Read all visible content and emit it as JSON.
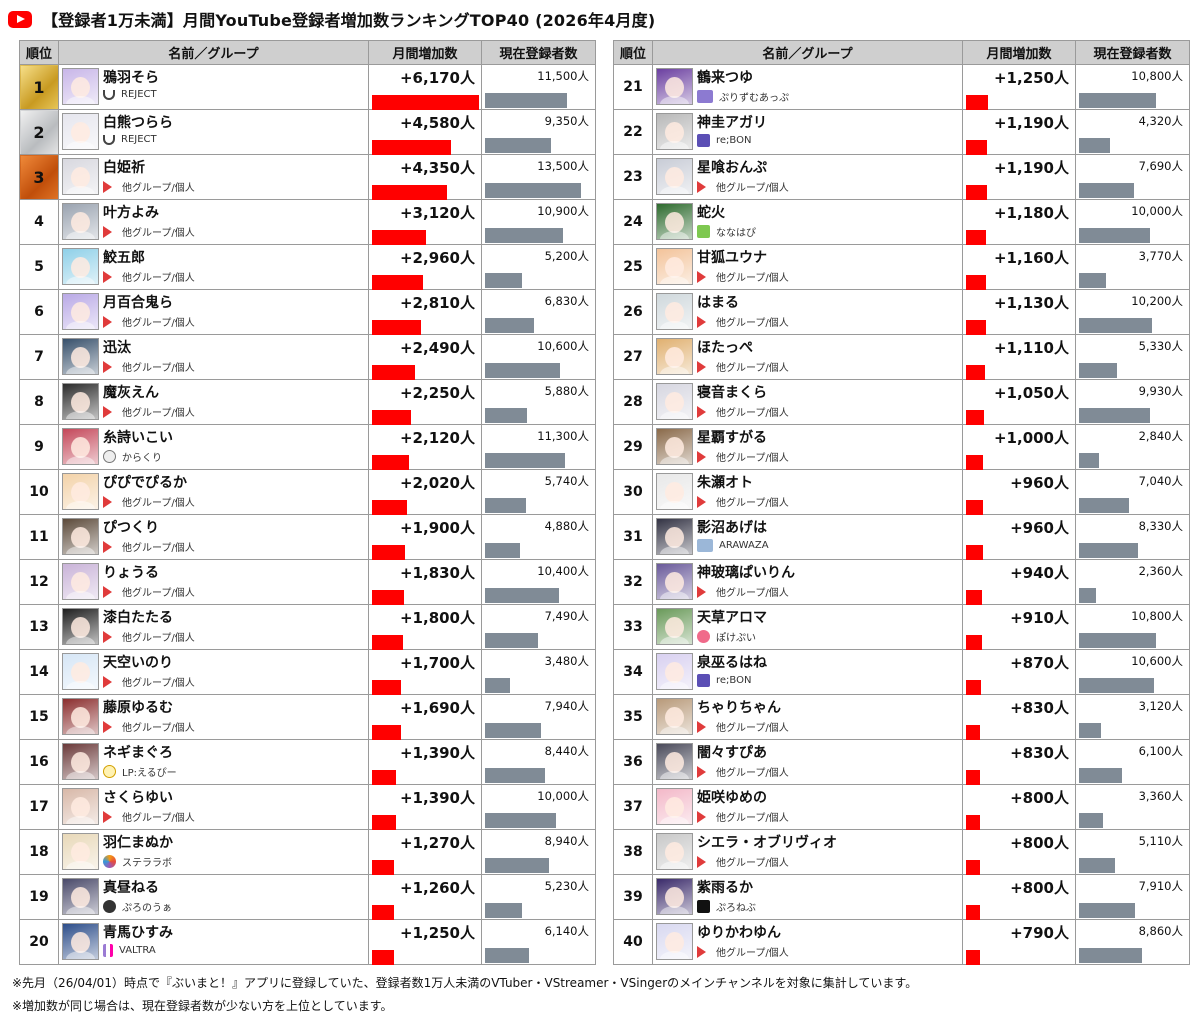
{
  "title": "【登録者1万未満】月間YouTube登録者増加数ランキングTOP40 (2026年4月度)",
  "colors": {
    "increase_bar": "#ff0000",
    "subscribers_bar": "#808b96",
    "header_bg": "#cfcfcf"
  },
  "headers": {
    "rank": "順位",
    "name": "名前／グループ",
    "increase": "月間増加数",
    "subscribers": "現在登録者数"
  },
  "entries": [
    {
      "rank": "1",
      "name": "鴉羽そら",
      "group": "REJECT",
      "icon": "reject",
      "increase": "+6,170人",
      "subscribers": "11,500人"
    },
    {
      "rank": "2",
      "name": "白熊つらら",
      "group": "REJECT",
      "icon": "reject",
      "increase": "+4,580人",
      "subscribers": "9,350人"
    },
    {
      "rank": "3",
      "name": "白姫祈",
      "group": "他グループ/個人",
      "icon": "play",
      "increase": "+4,350人",
      "subscribers": "13,500人"
    },
    {
      "rank": "4",
      "name": "叶方よみ",
      "group": "他グループ/個人",
      "icon": "play",
      "increase": "+3,120人",
      "subscribers": "10,900人"
    },
    {
      "rank": "5",
      "name": "鮫五郎",
      "group": "他グループ/個人",
      "icon": "play",
      "increase": "+2,960人",
      "subscribers": "5,200人"
    },
    {
      "rank": "6",
      "name": "月百合鬼ら",
      "group": "他グループ/個人",
      "icon": "play",
      "increase": "+2,810人",
      "subscribers": "6,830人"
    },
    {
      "rank": "7",
      "name": "迅汰",
      "group": "他グループ/個人",
      "icon": "play",
      "increase": "+2,490人",
      "subscribers": "10,600人"
    },
    {
      "rank": "8",
      "name": "魔灰えん",
      "group": "他グループ/個人",
      "icon": "play",
      "increase": "+2,250人",
      "subscribers": "5,880人"
    },
    {
      "rank": "9",
      "name": "糸詩いこい",
      "group": "からくり",
      "icon": "karakuri",
      "increase": "+2,120人",
      "subscribers": "11,300人"
    },
    {
      "rank": "10",
      "name": "ぴぴでぴるか",
      "group": "他グループ/個人",
      "icon": "play",
      "increase": "+2,020人",
      "subscribers": "5,740人"
    },
    {
      "rank": "11",
      "name": "ぴつくり",
      "group": "他グループ/個人",
      "icon": "play",
      "increase": "+1,900人",
      "subscribers": "4,880人"
    },
    {
      "rank": "12",
      "name": "りょうる",
      "group": "他グループ/個人",
      "icon": "play",
      "increase": "+1,830人",
      "subscribers": "10,400人"
    },
    {
      "rank": "13",
      "name": "漆白たたる",
      "group": "他グループ/個人",
      "icon": "play",
      "increase": "+1,800人",
      "subscribers": "7,490人"
    },
    {
      "rank": "14",
      "name": "天空いのり",
      "group": "他グループ/個人",
      "icon": "play",
      "increase": "+1,700人",
      "subscribers": "3,480人"
    },
    {
      "rank": "15",
      "name": "藤原ゆるむ",
      "group": "他グループ/個人",
      "icon": "play",
      "increase": "+1,690人",
      "subscribers": "7,940人"
    },
    {
      "rank": "16",
      "name": "ネギまぐろ",
      "group": "LP:えるぴー",
      "icon": "lp",
      "increase": "+1,390人",
      "subscribers": "8,440人"
    },
    {
      "rank": "17",
      "name": "さくらゆい",
      "group": "他グループ/個人",
      "icon": "play",
      "increase": "+1,390人",
      "subscribers": "10,000人"
    },
    {
      "rank": "18",
      "name": "羽仁まぬか",
      "group": "ステララボ",
      "icon": "stellar",
      "increase": "+1,270人",
      "subscribers": "8,940人"
    },
    {
      "rank": "19",
      "name": "真昼ねる",
      "group": "ぷろのうぁ",
      "icon": "proro",
      "increase": "+1,260人",
      "subscribers": "5,230人"
    },
    {
      "rank": "20",
      "name": "青馬ひすみ",
      "group": "VALTRA",
      "icon": "valtra",
      "increase": "+1,250人",
      "subscribers": "6,140人"
    },
    {
      "rank": "21",
      "name": "鶴来つゆ",
      "group": "ぷりずむあっぷ",
      "icon": "purizu",
      "increase": "+1,250人",
      "subscribers": "10,800人"
    },
    {
      "rank": "22",
      "name": "神圭アガリ",
      "group": "re;BON",
      "icon": "rebon",
      "increase": "+1,190人",
      "subscribers": "4,320人"
    },
    {
      "rank": "23",
      "name": "星喰おんぷ",
      "group": "他グループ/個人",
      "icon": "play",
      "increase": "+1,190人",
      "subscribers": "7,690人"
    },
    {
      "rank": "24",
      "name": "蛇火",
      "group": "ななはぴ",
      "icon": "nanahapi",
      "increase": "+1,180人",
      "subscribers": "10,000人"
    },
    {
      "rank": "25",
      "name": "甘狐ユウナ",
      "group": "他グループ/個人",
      "icon": "play",
      "increase": "+1,160人",
      "subscribers": "3,770人"
    },
    {
      "rank": "26",
      "name": "はまる",
      "group": "他グループ/個人",
      "icon": "play",
      "increase": "+1,130人",
      "subscribers": "10,200人"
    },
    {
      "rank": "27",
      "name": "ほたっぺ",
      "group": "他グループ/個人",
      "icon": "play",
      "increase": "+1,110人",
      "subscribers": "5,330人"
    },
    {
      "rank": "28",
      "name": "寝音まくら",
      "group": "他グループ/個人",
      "icon": "play",
      "increase": "+1,050人",
      "subscribers": "9,930人"
    },
    {
      "rank": "29",
      "name": "星覇すがる",
      "group": "他グループ/個人",
      "icon": "play",
      "increase": "+1,000人",
      "subscribers": "2,840人"
    },
    {
      "rank": "30",
      "name": "朱瀬オト",
      "group": "他グループ/個人",
      "icon": "play",
      "increase": "+960人",
      "subscribers": "7,040人"
    },
    {
      "rank": "31",
      "name": "影沼あげは",
      "group": "ARAWAZA",
      "icon": "arawaza",
      "increase": "+960人",
      "subscribers": "8,330人"
    },
    {
      "rank": "32",
      "name": "神玻璃ぱいりん",
      "group": "他グループ/個人",
      "icon": "play",
      "increase": "+940人",
      "subscribers": "2,360人"
    },
    {
      "rank": "33",
      "name": "天草アロマ",
      "group": "ぽけぷい",
      "icon": "poke",
      "increase": "+910人",
      "subscribers": "10,800人"
    },
    {
      "rank": "34",
      "name": "泉巫るはね",
      "group": "re;BON",
      "icon": "rebon",
      "increase": "+870人",
      "subscribers": "10,600人"
    },
    {
      "rank": "35",
      "name": "ちゃりちゃん",
      "group": "他グループ/個人",
      "icon": "play",
      "increase": "+830人",
      "subscribers": "3,120人"
    },
    {
      "rank": "36",
      "name": "闇々すぴあ",
      "group": "他グループ/個人",
      "icon": "play",
      "increase": "+830人",
      "subscribers": "6,100人"
    },
    {
      "rank": "37",
      "name": "姫咲ゆめの",
      "group": "他グループ/個人",
      "icon": "play",
      "increase": "+800人",
      "subscribers": "3,360人"
    },
    {
      "rank": "38",
      "name": "シエラ・オブリヴィオ",
      "group": "他グループ/個人",
      "icon": "play",
      "increase": "+800人",
      "subscribers": "5,110人"
    },
    {
      "rank": "39",
      "name": "紫雨るか",
      "group": "ぷろねぶ",
      "icon": "proronebu",
      "increase": "+800人",
      "subscribers": "7,910人"
    },
    {
      "rank": "40",
      "name": "ゆりかわゆん",
      "group": "他グループ/個人",
      "icon": "play",
      "increase": "+790人",
      "subscribers": "8,860人"
    }
  ],
  "footnotes": [
    "※先月（26/04/01）時点で『ぶいまと！』アプリに登録していた、登録者数1万人未満のVTuber・VStreamer・VSingerのメインチャンネルを対象に集計しています。",
    "※増加数が同じ場合は、現在登録者数が少ない方を上位としています。"
  ],
  "chart_data": {
    "type": "table",
    "title": "【登録者1万未満】月間YouTube登録者増加数ランキングTOP40 (2026年4月度)",
    "columns": [
      "順位",
      "名前／グループ",
      "月間増加数",
      "現在登録者数"
    ],
    "categories": [
      "鴉羽そら",
      "白熊つらら",
      "白姫祈",
      "叶方よみ",
      "鮫五郎",
      "月百合鬼ら",
      "迅汰",
      "魔灰えん",
      "糸詩いこい",
      "ぴぴでぴるか",
      "ぴつくり",
      "りょうる",
      "漆白たたる",
      "天空いのり",
      "藤原ゆるむ",
      "ネギまぐろ",
      "さくらゆい",
      "羽仁まぬか",
      "真昼ねる",
      "青馬ひすみ",
      "鶴来つゆ",
      "神圭アガリ",
      "星喰おんぷ",
      "蛇火",
      "甘狐ユウナ",
      "はまる",
      "ほたっぺ",
      "寝音まくら",
      "星覇すがる",
      "朱瀬オト",
      "影沼あげは",
      "神玻璃ぱいりん",
      "天草アロマ",
      "泉巫るはね",
      "ちゃりちゃん",
      "闇々すぴあ",
      "姫咲ゆめの",
      "シエラ・オブリヴィオ",
      "紫雨るか",
      "ゆりかわゆん"
    ],
    "series": [
      {
        "name": "月間増加数",
        "values": [
          6170,
          4580,
          4350,
          3120,
          2960,
          2810,
          2490,
          2250,
          2120,
          2020,
          1900,
          1830,
          1800,
          1700,
          1690,
          1390,
          1390,
          1270,
          1260,
          1250,
          1250,
          1190,
          1190,
          1180,
          1160,
          1130,
          1110,
          1050,
          1000,
          960,
          960,
          940,
          910,
          870,
          830,
          830,
          800,
          800,
          800,
          790
        ]
      },
      {
        "name": "現在登録者数",
        "values": [
          11500,
          9350,
          13500,
          10900,
          5200,
          6830,
          10600,
          5880,
          11300,
          5740,
          4880,
          10400,
          7490,
          3480,
          7940,
          8440,
          10000,
          8940,
          5230,
          6140,
          10800,
          4320,
          7690,
          10000,
          3770,
          10200,
          5330,
          9930,
          2840,
          7040,
          8330,
          2360,
          10800,
          10600,
          3120,
          6100,
          3360,
          5110,
          7910,
          8860
        ]
      }
    ]
  }
}
